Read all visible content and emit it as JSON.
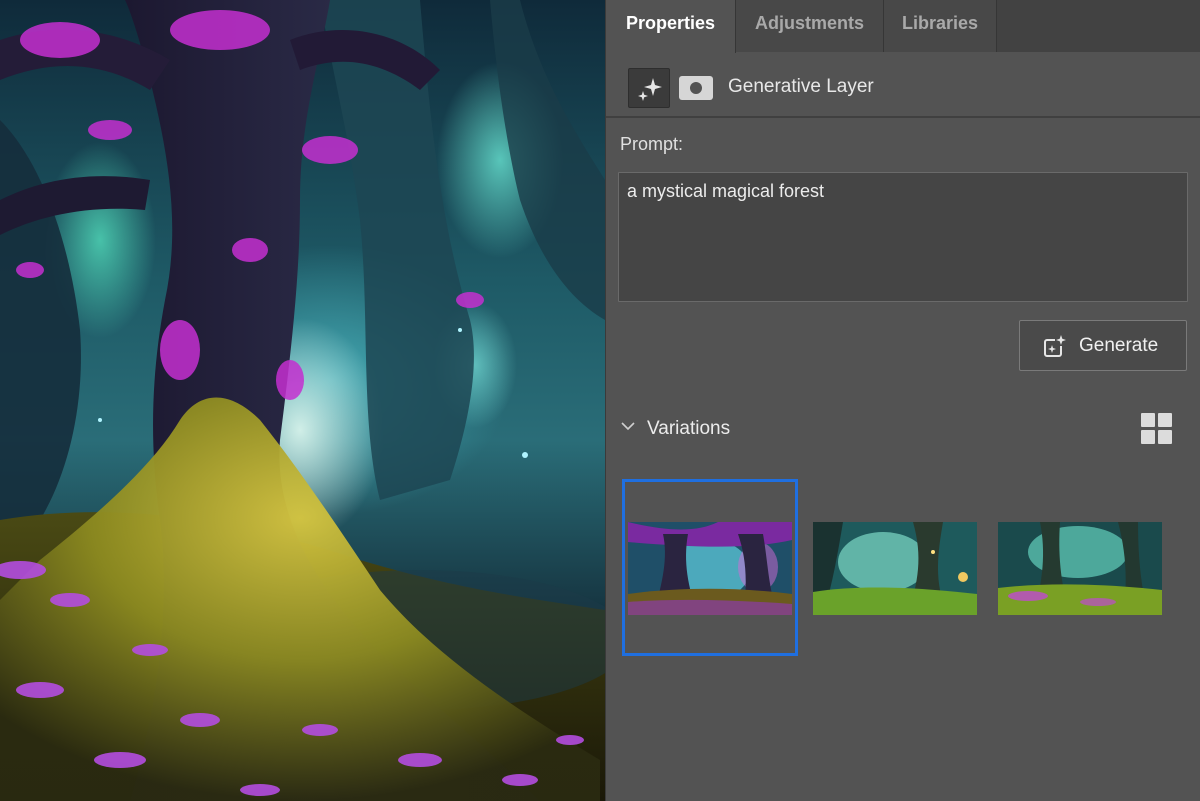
{
  "canvas": {
    "image": "mystical-forest-artwork"
  },
  "tabs": [
    {
      "label": "Properties",
      "active": true
    },
    {
      "label": "Adjustments",
      "active": false
    },
    {
      "label": "Libraries",
      "active": false
    }
  ],
  "layer": {
    "type_icon": "generative-sparkle-icon",
    "mask_icon": "layer-mask-icon",
    "name": "Generative Layer"
  },
  "prompt": {
    "label": "Prompt:",
    "value": "a mystical magical forest"
  },
  "generate_button": {
    "label": "Generate",
    "icon": "generate-sparkle-icon"
  },
  "variations": {
    "label": "Variations",
    "expanded": true,
    "view_icon": "grid-view-icon",
    "selected_index": 0,
    "count": 3
  },
  "colors": {
    "panel_bg": "#535353",
    "tab_bar_bg": "#424242",
    "selection": "#1f6fe0",
    "magenta_foliage": "#c42fd0",
    "teal_light": "#5fe0d0"
  }
}
